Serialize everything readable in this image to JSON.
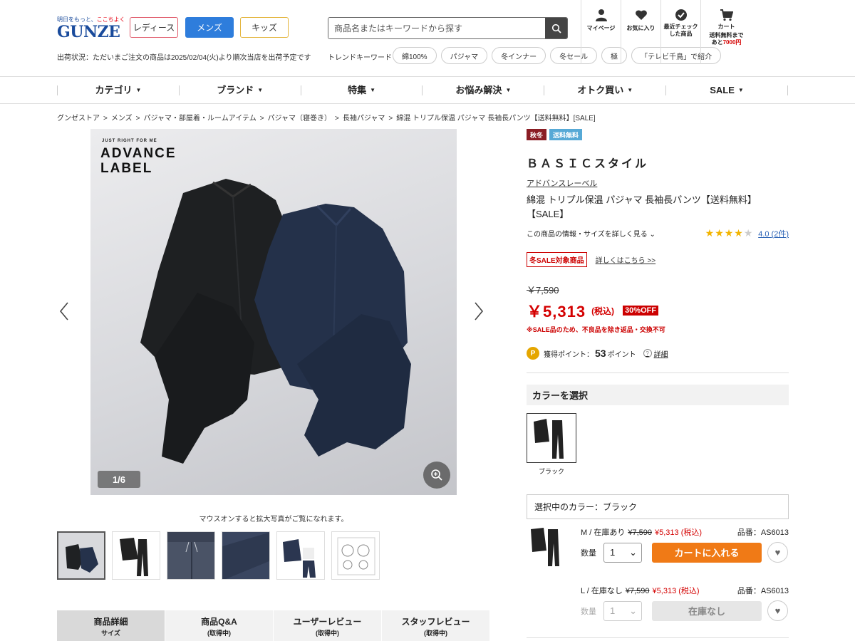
{
  "header": {
    "logo_tagline_pre": "明日をもっと、",
    "logo_tagline_hl": "ここちよく",
    "logo_text": "GUNZE",
    "categories": [
      "レディース",
      "メンズ",
      "キッズ"
    ],
    "search_placeholder": "商品名またはキーワードから探す",
    "ship_status": "出荷状況：ただいまご注文の商品は2025/02/04(火)より順次当店を出荷予定です",
    "trend_label": "トレンドキーワード",
    "trend_chips": [
      "綿100%",
      "パジャマ",
      "冬インナー",
      "冬セール",
      "極",
      "「テレビ千鳥」で紹介"
    ],
    "icons": {
      "mypage": "マイページ",
      "favorites": "お気に入り",
      "recent_1": "最近チェック",
      "recent_2": "した商品",
      "cart": "カート",
      "cart_note_1": "送料無料まで",
      "cart_note_2_pre": "あと",
      "cart_note_2_amount": "7000円"
    }
  },
  "nav": [
    "カテゴリ",
    "ブランド",
    "特集",
    "お悩み解決",
    "オトク買い",
    "SALE"
  ],
  "breadcrumb": [
    "グンゼストア",
    "メンズ",
    "パジャマ・部屋着・ルームアイテム",
    "パジャマ（寝巻き）",
    "長袖パジャマ",
    "綿混 トリプル保温 パジャマ 長袖長パンツ【送料無料】[SALE]"
  ],
  "gallery": {
    "brand_small": "JUST RIGHT FOR ME",
    "brand_line1": "ADVANCE",
    "brand_line2": "LABEL",
    "pager": "1/6",
    "zoom_note": "マウスオンすると拡大写真がご覧になれます。"
  },
  "tabs": [
    {
      "label": "商品詳細",
      "sub": "サイズ"
    },
    {
      "label": "商品Q&A",
      "sub": "(取得中)"
    },
    {
      "label": "ユーザーレビュー",
      "sub": "(取得中)"
    },
    {
      "label": "スタッフレビュー",
      "sub": "(取得中)"
    }
  ],
  "product": {
    "badges": [
      "秋冬",
      "送料無料"
    ],
    "style": "ＢＡＳＩＣスタイル",
    "brand": "アドバンスレーベル",
    "title": "綿混 トリプル保温 パジャマ 長袖長パンツ【送料無料】【SALE】",
    "info_link": "この商品の情報・サイズを詳しく見る",
    "rating": 4.0,
    "rating_text": "4.0 (2件)",
    "sale_tag": "冬SALE対象商品",
    "sale_link": "詳しくはこちら >>",
    "old_price": "￥7,590",
    "price": "￥5,313",
    "tax": "(税込)",
    "off": "30%OFF",
    "sale_note": "※SALE品のため、不良品を除き返品・交換不可",
    "points_label": "獲得ポイント：",
    "points": "53",
    "points_unit": "ポイント",
    "points_help": "詳細",
    "color_heading": "カラーを選択",
    "color_name": "ブラック",
    "selected_color": "選択中のカラー：ブラック"
  },
  "skus": [
    {
      "size": "M / 在庫あり",
      "old": "¥7,590",
      "price": "¥5,313 (税込)",
      "code": "品番：AS6013",
      "qty_label": "数量",
      "qty": "1",
      "button": "カートに入れる",
      "in_stock": true
    },
    {
      "size": "L / 在庫なし",
      "old": "¥7,590",
      "price": "¥5,313 (税込)",
      "code": "品番：AS6013",
      "qty_label": "数量",
      "qty": "1",
      "button": "在庫なし",
      "in_stock": false
    }
  ],
  "colors": {
    "accent_blue": "#2e7ddc",
    "sale_red": "#d40000",
    "cart_orange": "#f07a16"
  }
}
